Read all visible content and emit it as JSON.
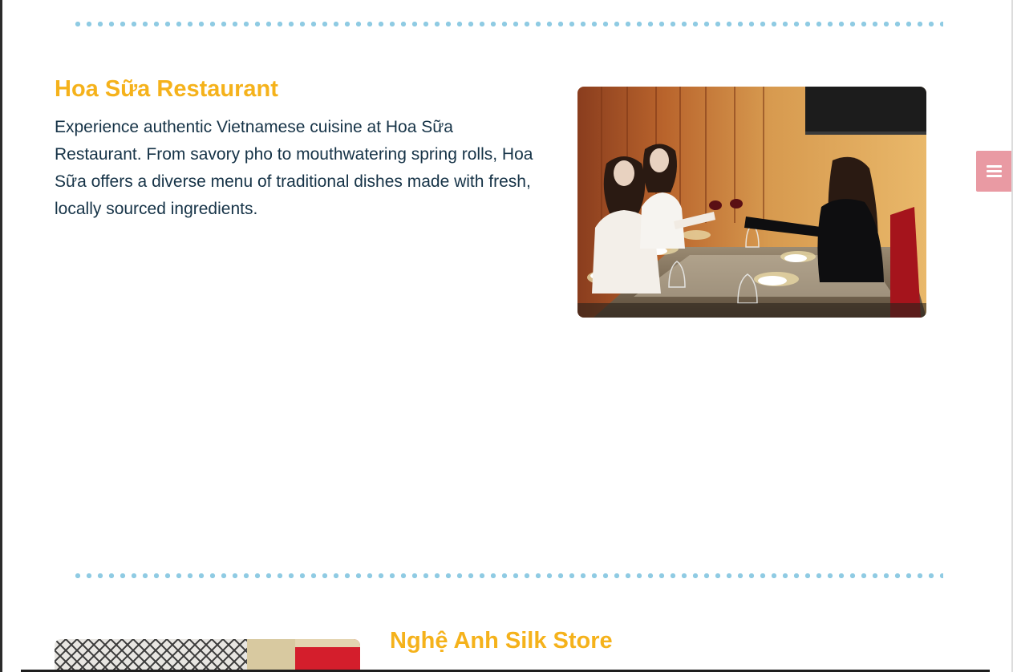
{
  "sections": [
    {
      "title": "Hoa Sữa Restaurant",
      "description": "Experience authentic Vietnamese cuisine at Hoa Sữa Restaurant. From savory pho to mouthwatering spring rolls, Hoa Sữa offers a diverse menu of traditional dishes made with fresh, locally sourced ingredients."
    },
    {
      "title": "Nghệ Anh Silk Store"
    }
  ],
  "menu_button": {
    "icon": "hamburger-menu-icon"
  },
  "colors": {
    "title": "#f5b21b",
    "text": "#163347",
    "divider_dots": "#8fcbe3",
    "menu_button": "#e99aa3"
  }
}
